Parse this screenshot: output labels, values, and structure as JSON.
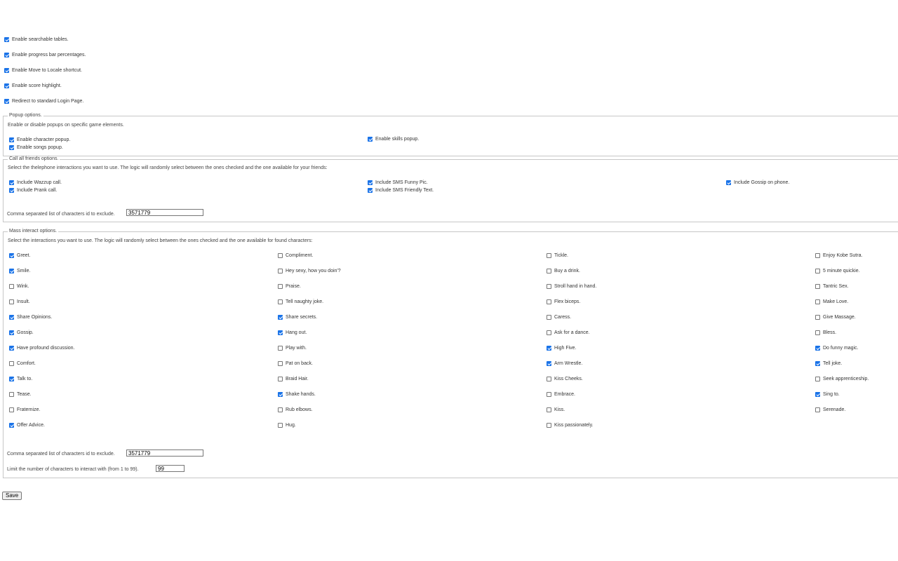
{
  "general": [
    {
      "label": "Enable searchable tables.",
      "checked": true
    },
    {
      "label": "Enable progress bar percentages.",
      "checked": true
    },
    {
      "label": "Enable Move to Locale shortcut.",
      "checked": true
    },
    {
      "label": "Enable score highlight.",
      "checked": true
    },
    {
      "label": "Redirect to standard Login Page.",
      "checked": true
    }
  ],
  "popup": {
    "legend": "Popup options.",
    "description": "Enable or disable popups on specific game elements.",
    "options": [
      {
        "label": "Enable character popup.",
        "checked": true
      },
      {
        "label": "Enable skills popup.",
        "checked": true
      },
      {
        "label": "Enable songs popup.",
        "checked": true
      }
    ]
  },
  "call_friends": {
    "legend": "Call all friends options.",
    "description": "Select the thelephone interactions you want to use. The logic will randomly select between the ones checked and the one available for your friends:",
    "options": [
      {
        "label": "Include Wazzup call.",
        "checked": true
      },
      {
        "label": "Include SMS Funny Pic.",
        "checked": true
      },
      {
        "label": "Include Gossip on phone.",
        "checked": true
      },
      {
        "label": "Include Prank call.",
        "checked": true
      },
      {
        "label": "Include SMS Friendly Text.",
        "checked": true
      }
    ],
    "exclude_label": "Comma separated list of characters id to exclude.",
    "exclude_value": "3571779"
  },
  "mass_interact": {
    "legend": "Mass interact options.",
    "description": "Select the interactions you want to use. The logic will randomly select between the ones checked and the one available for found characters:",
    "columns": [
      [
        {
          "label": "Greet.",
          "checked": true
        },
        {
          "label": "Smile.",
          "checked": true
        },
        {
          "label": "Wink.",
          "checked": false
        },
        {
          "label": "Insult.",
          "checked": false
        },
        {
          "label": "Share Opinions.",
          "checked": true
        },
        {
          "label": "Gossip.",
          "checked": true
        },
        {
          "label": "Have profound discussion.",
          "checked": true
        },
        {
          "label": "Comfort.",
          "checked": false
        },
        {
          "label": "Talk to.",
          "checked": true
        },
        {
          "label": "Tease.",
          "checked": false
        },
        {
          "label": "Fraternize.",
          "checked": false
        },
        {
          "label": "Offer Advice.",
          "checked": true
        }
      ],
      [
        {
          "label": "Compliment.",
          "checked": false
        },
        {
          "label": "Hey sexy, how you doin'?",
          "checked": false
        },
        {
          "label": "Praise.",
          "checked": false
        },
        {
          "label": "Tell naughty joke.",
          "checked": false
        },
        {
          "label": "Share secrets.",
          "checked": true
        },
        {
          "label": "Hang out.",
          "checked": true
        },
        {
          "label": "Play with.",
          "checked": false
        },
        {
          "label": "Pat on back.",
          "checked": false
        },
        {
          "label": "Braid Hair.",
          "checked": false
        },
        {
          "label": "Shake hands.",
          "checked": true
        },
        {
          "label": "Rub elbows.",
          "checked": false
        },
        {
          "label": "Hug.",
          "checked": false
        }
      ],
      [
        {
          "label": "Tickle.",
          "checked": false
        },
        {
          "label": "Buy a drink.",
          "checked": false
        },
        {
          "label": "Stroll hand in hand.",
          "checked": false
        },
        {
          "label": "Flex biceps.",
          "checked": false
        },
        {
          "label": "Caress.",
          "checked": false
        },
        {
          "label": "Ask for a dance.",
          "checked": false
        },
        {
          "label": "High Five.",
          "checked": true
        },
        {
          "label": "Arm Wrestle.",
          "checked": true
        },
        {
          "label": "Kiss Cheeks.",
          "checked": false
        },
        {
          "label": "Embrace.",
          "checked": false
        },
        {
          "label": "Kiss.",
          "checked": false
        },
        {
          "label": "Kiss passionately.",
          "checked": false
        }
      ],
      [
        {
          "label": "Enjoy Kobe Sutra.",
          "checked": false
        },
        {
          "label": "5 minute quickie.",
          "checked": false
        },
        {
          "label": "Tantric Sex.",
          "checked": false
        },
        {
          "label": "Make Love.",
          "checked": false
        },
        {
          "label": "Give Massage.",
          "checked": false
        },
        {
          "label": "Bless.",
          "checked": false
        },
        {
          "label": "Do funny magic.",
          "checked": true
        },
        {
          "label": "Tell joke.",
          "checked": true
        },
        {
          "label": "Seek apprenticeship.",
          "checked": false
        },
        {
          "label": "Sing to.",
          "checked": true
        },
        {
          "label": "Serenade.",
          "checked": false
        }
      ]
    ],
    "exclude_label": "Comma separated list of characters id to exclude.",
    "exclude_value": "3571779",
    "limit_label": "Limit the number of characters to interact with (from 1 to 99).",
    "limit_value": "99"
  },
  "save_label": "Save",
  "colors": {
    "checkbox_checked": "#1a73e8",
    "border": "#c7c7c7"
  }
}
